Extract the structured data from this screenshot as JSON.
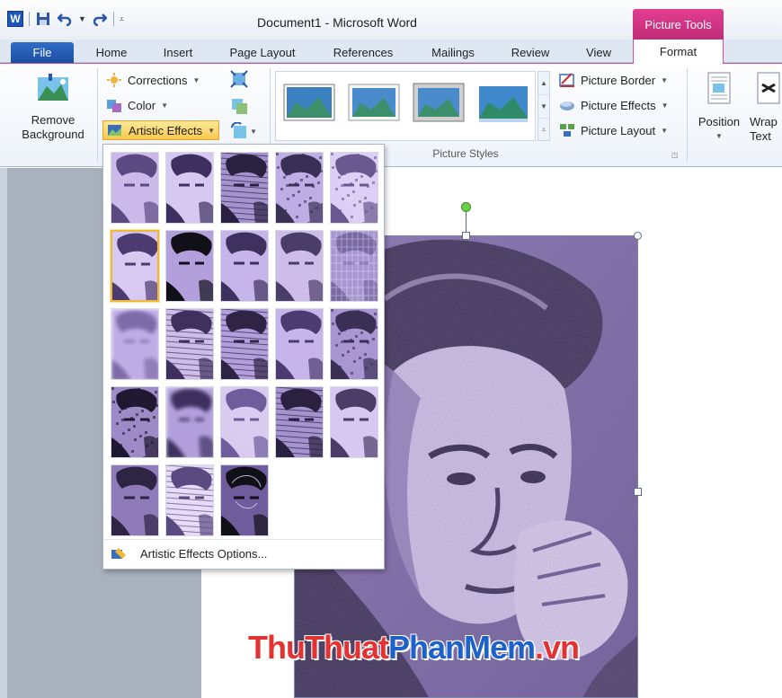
{
  "window": {
    "doc_title": "Document1 - Microsoft Word",
    "context_header": "Picture Tools"
  },
  "qat": {
    "app_icon": "word-logo",
    "app_letter": "W",
    "save": "save-icon",
    "undo": "undo-icon",
    "redo": "redo-icon",
    "customize": "customize-icon"
  },
  "tabs": {
    "file": "File",
    "home": "Home",
    "insert": "Insert",
    "page_layout": "Page Layout",
    "references": "References",
    "mailings": "Mailings",
    "review": "Review",
    "view": "View",
    "format": "Format"
  },
  "ribbon": {
    "remove_background_line1": "Remove",
    "remove_background_line2": "Background",
    "corrections": "Corrections",
    "color": "Color",
    "artistic_effects": "Artistic Effects",
    "picture_styles_label": "Picture Styles",
    "picture_border": "Picture Border",
    "picture_effects": "Picture Effects",
    "picture_layout": "Picture Layout",
    "position": "Position",
    "wrap_line1": "Wrap",
    "wrap_line2": "Text"
  },
  "dropdown": {
    "options_label": "Artistic Effects Options...",
    "effects_count": 23,
    "selected_index": 5
  },
  "watermark": {
    "part1": "ThuThuat",
    "part2": "PhanMem",
    "part3": ".vn"
  },
  "colors": {
    "accent_pink": "#d64c95",
    "file_blue": "#2f6dc7",
    "selection_gold": "#f1b73a",
    "picture_tint": "#b39fdc"
  }
}
